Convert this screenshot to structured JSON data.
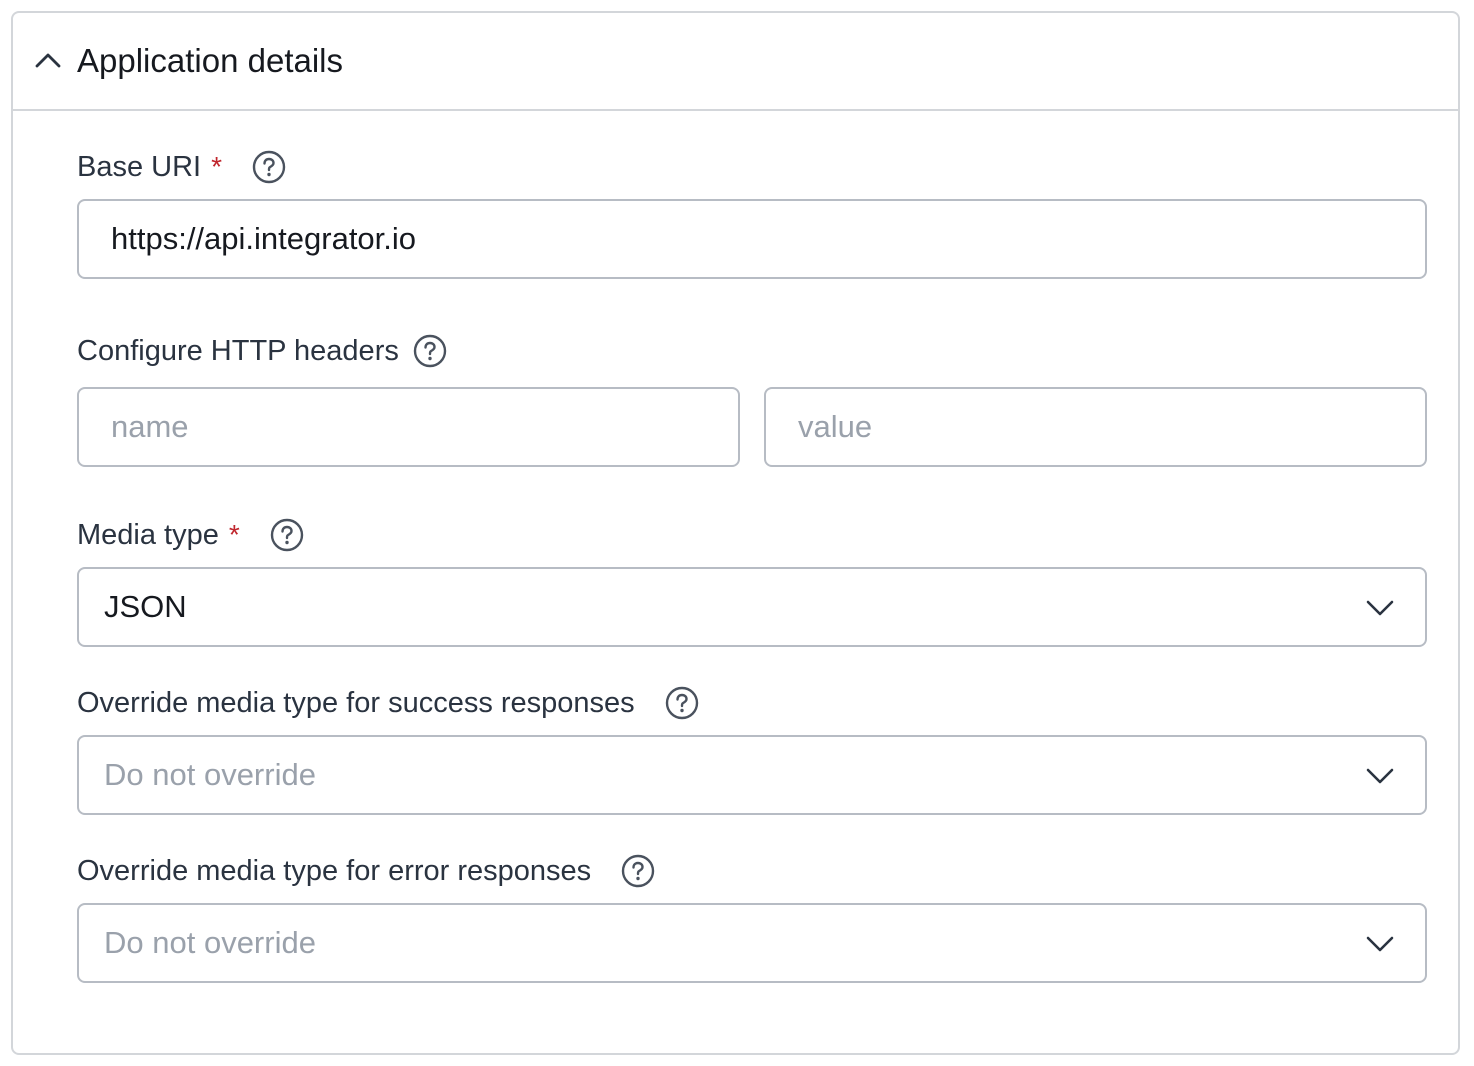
{
  "section": {
    "title": "Application details",
    "collapse_icon": "chevron-up-icon"
  },
  "base_uri": {
    "label": "Base URI",
    "required_mark": "*",
    "help_icon": "help-circle-icon",
    "value": "https://api.integrator.io"
  },
  "http_headers": {
    "label": "Configure HTTP headers",
    "help_icon": "help-circle-icon",
    "name_placeholder": "name",
    "value_placeholder": "value"
  },
  "media_type": {
    "label": "Media type",
    "required_mark": "*",
    "help_icon": "help-circle-icon",
    "selected": "JSON"
  },
  "success_override": {
    "label": "Override media type for success responses",
    "help_icon": "help-circle-icon",
    "selected": "Do not override"
  },
  "error_override": {
    "label": "Override media type for error responses",
    "help_icon": "help-circle-icon",
    "selected": "Do not override"
  },
  "colors": {
    "required": "#c0262d",
    "border": "#b7bcc4",
    "placeholder": "#9aa1ab",
    "label": "#2a3340"
  }
}
